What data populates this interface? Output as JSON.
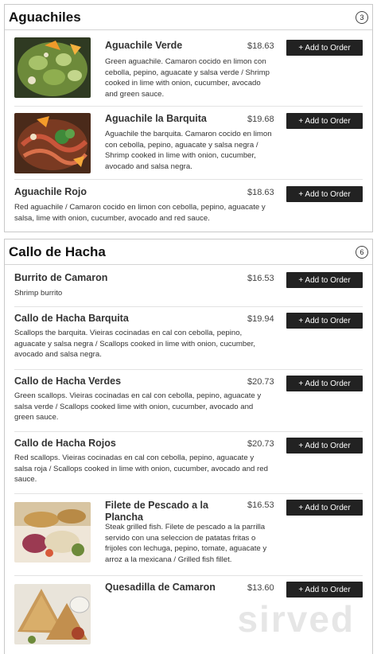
{
  "sections": [
    {
      "title": "Aguachiles",
      "count": "3",
      "items": [
        {
          "name": "Aguachile Verde",
          "price": "$18.63",
          "description": "Green aguachile. Camaron cocido en limon con cebolla, pepino, aguacate y salsa verde / Shrimp cooked in lime with onion, cucumber, avocado and green sauce.",
          "button": "+ Add to Order"
        },
        {
          "name": "Aguachile la Barquita",
          "price": "$19.68",
          "description": "Aguachile the barquita. Camaron cocido en limon con cebolla, pepino, aguacate y salsa negra / Shrimp cooked in lime with onion, cucumber, avocado and salsa negra.",
          "button": "+ Add to Order"
        },
        {
          "name": "Aguachile Rojo",
          "price": "$18.63",
          "description": "Red aguachile / Camaron cocido en limon con cebolla, pepino, aguacate y salsa, lime with onion, cucumber, avocado and red sauce.",
          "button": "+ Add to Order"
        }
      ]
    },
    {
      "title": "Callo de Hacha",
      "count": "6",
      "items": [
        {
          "name": "Burrito de Camaron",
          "price": "$16.53",
          "description": "Shrimp burrito",
          "button": "+ Add to Order"
        },
        {
          "name": "Callo de Hacha Barquita",
          "price": "$19.94",
          "description": "Scallops the barquita. Vieiras cocinadas en cal con cebolla, pepino, aguacate y salsa negra / Scallops cooked in lime with onion, cucumber, avocado and salsa negra.",
          "button": "+ Add to Order"
        },
        {
          "name": "Callo de Hacha Verdes",
          "price": "$20.73",
          "description": "Green scallops. Vieiras cocinadas en cal con cebolla, pepino, aguacate y salsa verde / Scallops cooked lime with onion, cucumber, avocado and green sauce.",
          "button": "+ Add to Order"
        },
        {
          "name": "Callo de Hacha Rojos",
          "price": "$20.73",
          "description": "Red scallops. Vieiras cocinadas en cal con cebolla, pepino, aguacate y salsa roja / Scallops cooked in lime with onion, cucumber, avocado and red sauce.",
          "button": "+ Add to Order"
        },
        {
          "name": "Filete de Pescado a la Plancha",
          "price": "$16.53",
          "description": "Steak grilled fish. Filete de pescado a la parrilla servido con una seleccion de patatas fritas o frijoles con lechuga, pepino, tomate, aguacate y arroz a la mexicana / Grilled fish fillet.",
          "button": "+ Add to Order"
        },
        {
          "name": "Quesadilla de Camaron",
          "price": "$13.60",
          "description": "",
          "button": "+ Add to Order"
        }
      ]
    }
  ],
  "watermark": "sirved"
}
